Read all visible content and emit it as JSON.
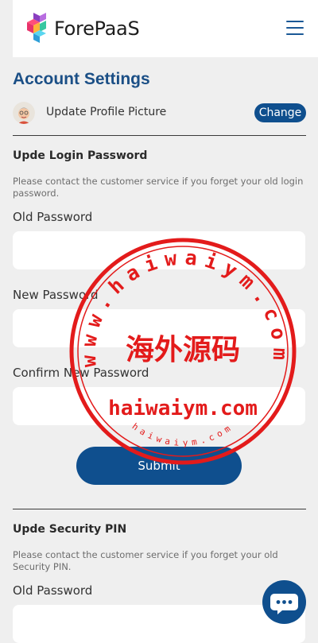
{
  "header": {
    "brand": "ForePaaS",
    "logo_icon": "forepaas-logo-icon",
    "menu_icon": "hamburger-menu-icon"
  },
  "page": {
    "title": "Account Settings"
  },
  "profile": {
    "label": "Update Profile Picture",
    "change_label": "Change",
    "avatar_icon": "avatar"
  },
  "login_password": {
    "title": "Upde Login Password",
    "hint": "Please contact the customer service if you forget your old login password.",
    "old_label": "Old Password",
    "new_label": "New Password",
    "confirm_label": "Confirm New Password",
    "submit_label": "Submit"
  },
  "security_pin": {
    "title": "Upde Security PIN",
    "hint": "Please contact the customer service if you forget your old Security PIN.",
    "old_label": "Old Password"
  },
  "watermark": {
    "arc_text": "www.haiwaiym.com",
    "center_text": "海外源码",
    "domain_text": "haiwaiym.com",
    "small_arc_text": "haiwaiym.com"
  },
  "chat": {
    "icon": "chat-bubble-icon"
  },
  "colors": {
    "primary": "#0f4f8e",
    "title": "#1b4f86",
    "stamp": "#e31b1b",
    "background": "#efefef"
  }
}
